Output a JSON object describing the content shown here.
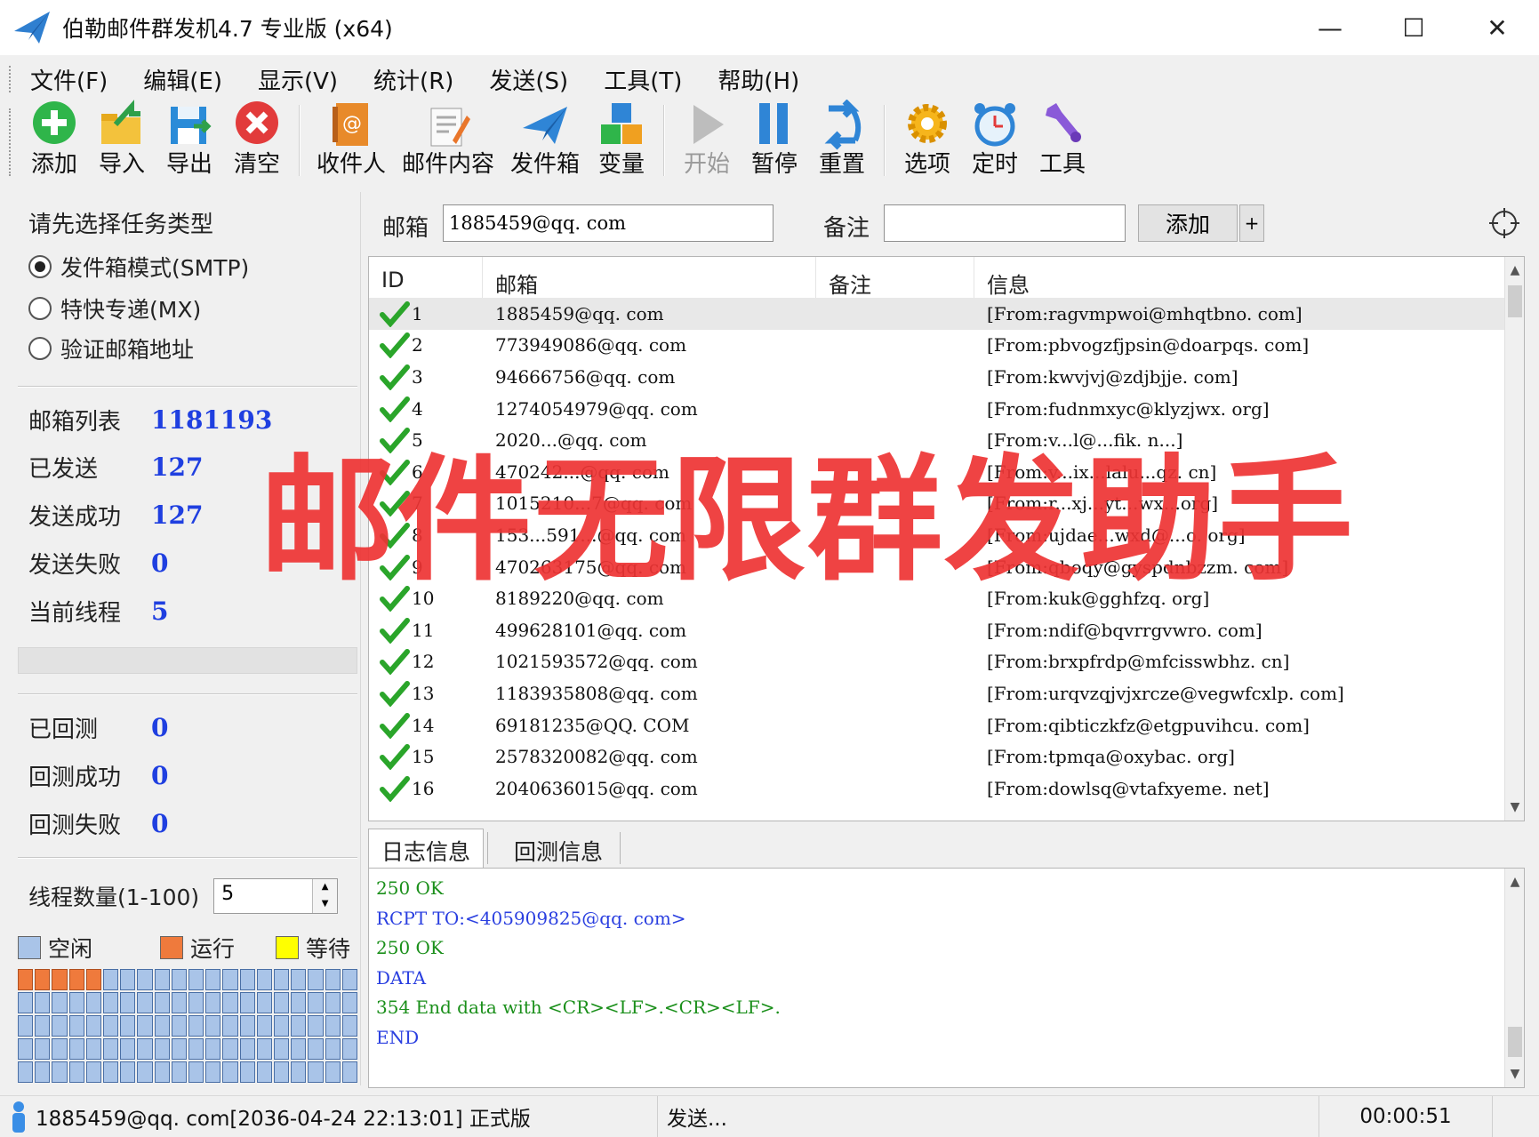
{
  "window": {
    "title": "伯勒邮件群发机4.7 专业版 (x64)",
    "minimize_glyph": "—",
    "maximize_glyph": "☐",
    "close_glyph": "✕"
  },
  "menu": [
    "文件(F)",
    "编辑(E)",
    "显示(V)",
    "统计(R)",
    "发送(S)",
    "工具(T)",
    "帮助(H)"
  ],
  "toolbar": {
    "add": "添加",
    "import": "导入",
    "export": "导出",
    "clear": "清空",
    "recipients": "收件人",
    "content": "邮件内容",
    "outbox": "发件箱",
    "variables": "变量",
    "start": "开始",
    "pause": "暂停",
    "reset": "重置",
    "options": "选项",
    "timer": "定时",
    "tools": "工具"
  },
  "left": {
    "heading": "请先选择任务类型",
    "modes": [
      {
        "label": "发件箱模式(SMTP)",
        "checked": true
      },
      {
        "label": "特快专递(MX)",
        "checked": false
      },
      {
        "label": "验证邮箱地址",
        "checked": false
      }
    ],
    "stats": [
      {
        "label": "邮箱列表",
        "value": "1181193"
      },
      {
        "label": "已发送",
        "value": "127"
      },
      {
        "label": "发送成功",
        "value": "127"
      },
      {
        "label": "发送失败",
        "value": "0"
      },
      {
        "label": "当前线程",
        "value": "5"
      }
    ],
    "progress_fraction": 0.0,
    "verify_stats": [
      {
        "label": "已回测",
        "value": "0"
      },
      {
        "label": "回测成功",
        "value": "0"
      },
      {
        "label": "回测失败",
        "value": "0"
      }
    ],
    "thread_count_label": "线程数量(1-100)",
    "thread_count_value": "5",
    "legend": [
      {
        "label": "空闲",
        "color": "#a9c4e8"
      },
      {
        "label": "运行",
        "color": "#ef7a3c"
      },
      {
        "label": "等待",
        "color": "#ffff00"
      }
    ],
    "threads_total": 100,
    "threads_running": 5
  },
  "inputbar": {
    "email_label": "邮箱",
    "email_value": "1885459@qq. com",
    "note_label": "备注",
    "note_value": "",
    "add_button": "添加",
    "plus_button": "+"
  },
  "table": {
    "columns": [
      "ID",
      "邮箱",
      "备注",
      "信息"
    ],
    "rows": [
      {
        "id": "1",
        "email": "1885459@qq. com",
        "note": "",
        "info": "[From:ragvmpwoi@mhqtbno. com]"
      },
      {
        "id": "2",
        "email": "773949086@qq. com",
        "note": "",
        "info": "[From:pbvogzfjpsin@doarpqs. com]"
      },
      {
        "id": "3",
        "email": "94666756@qq. com",
        "note": "",
        "info": "[From:kwvjvj@zdjbjje. com]"
      },
      {
        "id": "4",
        "email": "1274054979@qq. com",
        "note": "",
        "info": "[From:fudnmxyc@klyzjwx. org]"
      },
      {
        "id": "5",
        "email": "2020...@qq. com",
        "note": "",
        "info": "[From:v...l@...fik. n...]"
      },
      {
        "id": "6",
        "email": "470242...@qq. com",
        "note": "",
        "info": "[From:v...ix...lalu...qz. cn]"
      },
      {
        "id": "7",
        "email": "1015210...7@qq. com",
        "note": "",
        "info": "[From:r...xj...yt...wx...org]"
      },
      {
        "id": "8",
        "email": "153...591...@qq. com",
        "note": "",
        "info": "[From:ujdae...wxd@...o. org]"
      },
      {
        "id": "9",
        "email": "470263175@qq. com",
        "note": "",
        "info": "[From:qboqy@gyspdnbzzm. com]"
      },
      {
        "id": "10",
        "email": "8189220@qq. com",
        "note": "",
        "info": "[From:kuk@gghfzq. org]"
      },
      {
        "id": "11",
        "email": "499628101@qq. com",
        "note": "",
        "info": "[From:ndif@bqvrrgvwro. com]"
      },
      {
        "id": "12",
        "email": "1021593572@qq. com",
        "note": "",
        "info": "[From:brxpfrdp@mfcisswbhz. cn]"
      },
      {
        "id": "13",
        "email": "1183935808@qq. com",
        "note": "",
        "info": "[From:urqvzqjvjxrcze@vegwfcxlp. com]"
      },
      {
        "id": "14",
        "email": "69181235@QQ. COM",
        "note": "",
        "info": "[From:qibticzkfz@etgpuvihcu. com]"
      },
      {
        "id": "15",
        "email": "2578320082@qq. com",
        "note": "",
        "info": "[From:tpmqa@oxybac. org]"
      },
      {
        "id": "16",
        "email": "2040636015@qq. com",
        "note": "",
        "info": "[From:dowlsq@vtafxyeme. net]"
      }
    ]
  },
  "tabs": [
    "日志信息",
    "回测信息"
  ],
  "log": [
    {
      "text": "250 OK",
      "color": "#1a8f1a"
    },
    {
      "text": "RCPT TO:<405909825@qq. com>",
      "color": "#2a3fe0"
    },
    {
      "text": "250 OK",
      "color": "#1a8f1a"
    },
    {
      "text": "DATA",
      "color": "#2a3fe0"
    },
    {
      "text": "354 End data with <CR><LF>.<CR><LF>.",
      "color": "#1a8f1a"
    },
    {
      "text": "END",
      "color": "#2a3fe0"
    }
  ],
  "status": {
    "account": "1885459@qq. com[2036-04-24 22:13:01] 正式版",
    "state": "发送...",
    "elapsed": "00:00:51"
  },
  "watermark": "邮件无限群发助手"
}
